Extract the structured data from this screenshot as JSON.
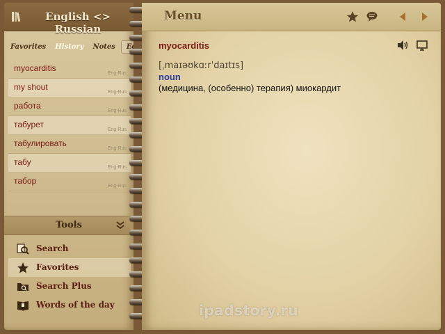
{
  "header": {
    "title": "English <> Russian",
    "menu_title": "Menu"
  },
  "tabs": [
    {
      "label": "Favorites"
    },
    {
      "label": "History"
    },
    {
      "label": "Notes"
    },
    {
      "label": "Edit"
    }
  ],
  "history": [
    {
      "word": "myocarditis",
      "direction": "Eng-Rus"
    },
    {
      "word": "my shout",
      "direction": "Eng-Rus"
    },
    {
      "word": "работа",
      "direction": "Eng-Rus"
    },
    {
      "word": "табурет",
      "direction": "Eng-Rus"
    },
    {
      "word": "табулировать",
      "direction": "Eng-Rus"
    },
    {
      "word": "табу",
      "direction": "Eng-Rus"
    },
    {
      "word": "табор",
      "direction": "Eng-Rus"
    }
  ],
  "tools": {
    "title": "Tools",
    "items": [
      {
        "label": "Search",
        "icon": "search-icon"
      },
      {
        "label": "Favorites",
        "icon": "star-icon"
      },
      {
        "label": "Search Plus",
        "icon": "search-plus-icon"
      },
      {
        "label": "Words of the day",
        "icon": "words-of-the-day-icon"
      }
    ]
  },
  "entry": {
    "headword": "myocarditis",
    "transcription": "[ˌmaɪəʊkɑːrˈdaɪtɪs]",
    "part_of_speech": "noun",
    "translation": "(медицина, (особенно) терапия) миокардит"
  },
  "watermark": "ipadstory.ru",
  "colors": {
    "accent_red": "#7a1b14",
    "pos_blue": "#2a3fa0",
    "header_brown": "#7a5a32",
    "paper": "#e3d2a6"
  }
}
